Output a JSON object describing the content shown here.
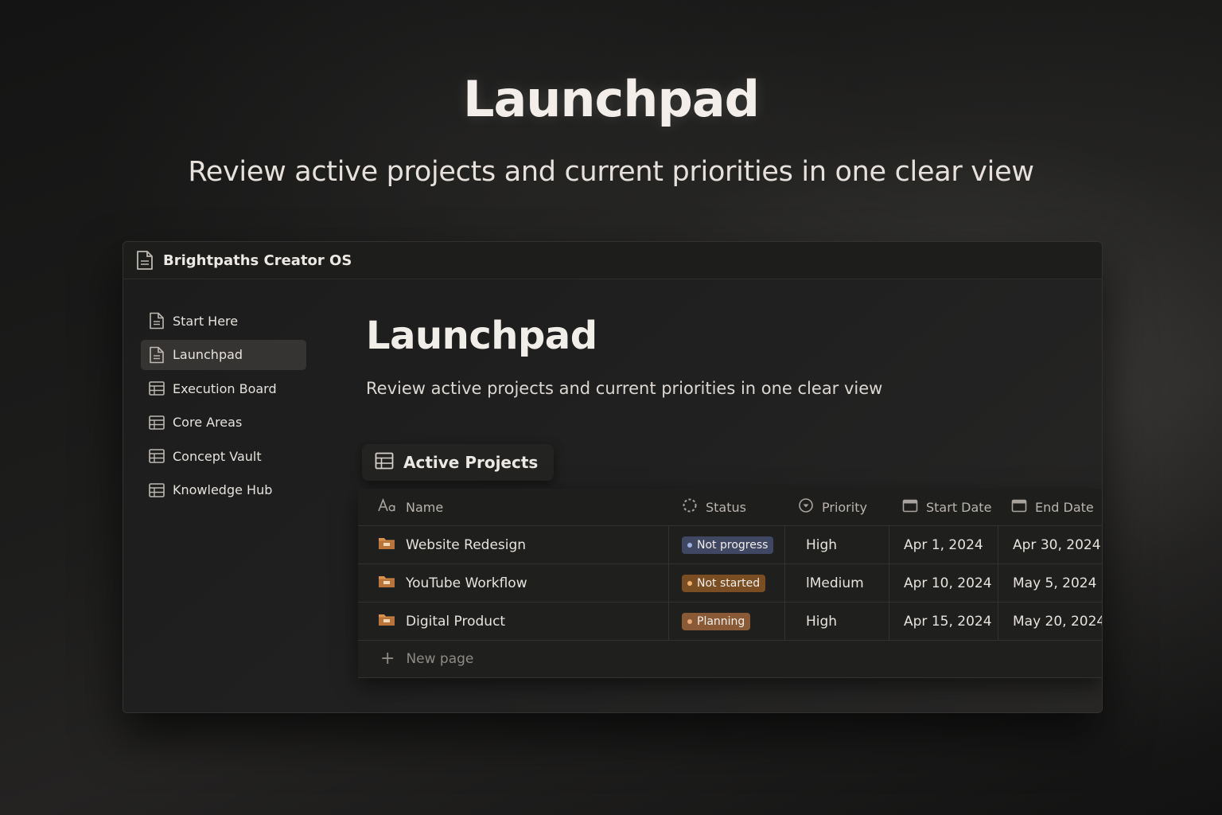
{
  "hero": {
    "title": "Launchpad",
    "subtitle": "Review active projects and current priorities in one clear view"
  },
  "window": {
    "title": "Brightpaths Creator OS",
    "title_icon": "document-icon"
  },
  "sidebar": {
    "items": [
      {
        "label": "Start Here",
        "icon": "document-icon",
        "active": false
      },
      {
        "label": "Launchpad",
        "icon": "document-icon",
        "active": true
      },
      {
        "label": "Execution Board",
        "icon": "table-icon",
        "active": false
      },
      {
        "label": "Core Areas",
        "icon": "table-icon",
        "active": false
      },
      {
        "label": "Concept Vault",
        "icon": "table-icon",
        "active": false
      },
      {
        "label": "Knowledge Hub",
        "icon": "table-icon",
        "active": false
      }
    ]
  },
  "page": {
    "title": "Launchpad",
    "description": "Review active projects and current priorities in one clear view"
  },
  "view": {
    "label": "Active Projects",
    "icon": "table-icon"
  },
  "table": {
    "columns": [
      {
        "label": "Name",
        "icon": "text-property-icon"
      },
      {
        "label": "Status",
        "icon": "status-property-icon"
      },
      {
        "label": "Priority",
        "icon": "select-property-icon"
      },
      {
        "label": "Start Date",
        "icon": "calendar-icon"
      },
      {
        "label": "End Date",
        "icon": "calendar-icon"
      }
    ],
    "rows": [
      {
        "name": "Website Redesign",
        "icon": "folder-icon",
        "status": "Not progress",
        "priority": "High",
        "start": "Apr 1, 2024",
        "end": "Apr 30, 2024"
      },
      {
        "name": "YouTube Workflow",
        "icon": "folder-icon",
        "status": "Not started",
        "priority": "lMedium",
        "start": "Apr 10, 2024",
        "end": "May 5, 2024"
      },
      {
        "name": "Digital Product",
        "icon": "folder-icon",
        "status": "Planning",
        "priority": "High",
        "start": "Apr 15, 2024",
        "end": "May 20, 2024"
      }
    ],
    "new_page_label": "New page"
  },
  "colors": {
    "status_not_progress_bg": "#3f4763",
    "status_not_progress_dot": "#9fb0e0",
    "status_not_started_bg": "#7a4e22",
    "status_not_started_dot": "#f0b070",
    "status_planning_bg": "#8a5a36",
    "status_planning_dot": "#e7a977",
    "folder_icon": "#d9924e"
  }
}
